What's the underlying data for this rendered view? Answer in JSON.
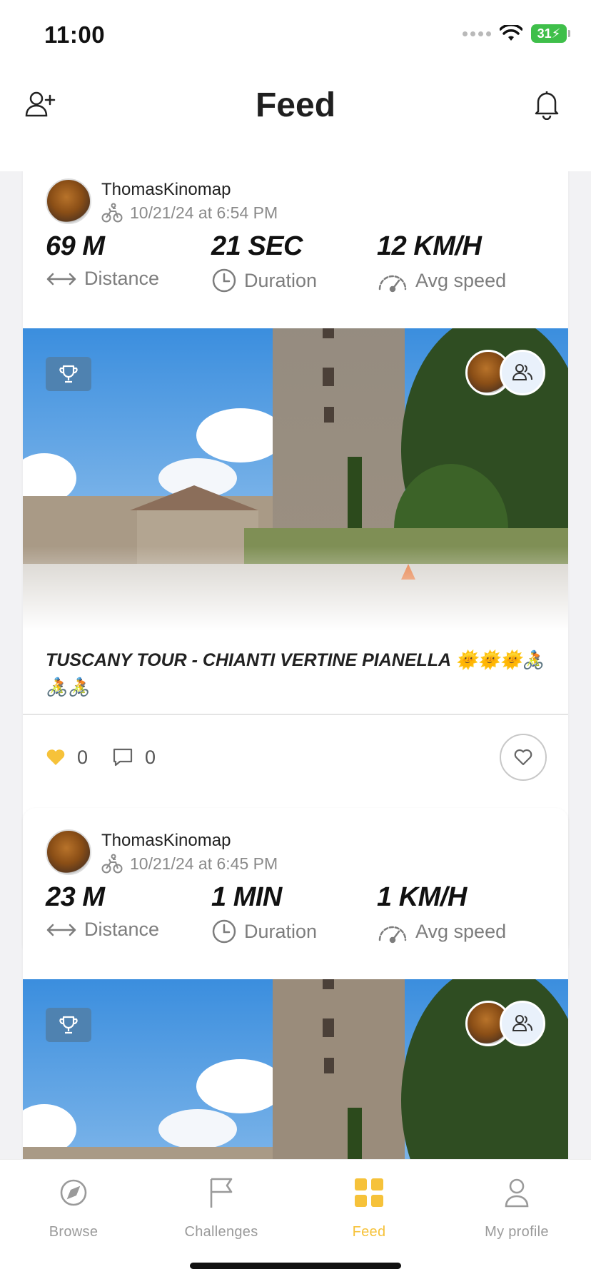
{
  "status_bar": {
    "time": "11:00",
    "battery": "31"
  },
  "header": {
    "title": "Feed",
    "left_icon": "add-friend-icon",
    "right_icon": "bell-icon"
  },
  "posts": [
    {
      "username": "ThomasKinomap",
      "date": "10/21/24 at 6:54 PM",
      "stats": [
        {
          "value": "69 M",
          "label": "Distance",
          "icon": "arrows-horizontal-icon"
        },
        {
          "value": "21 SEC",
          "label": "Duration",
          "icon": "clock-icon"
        },
        {
          "value": "12 KM/H",
          "label": "Avg speed",
          "icon": "speedometer-icon"
        }
      ],
      "title": "TUSCANY TOUR - CHIANTI VERTINE PIANELLA 🌞🌞🌞🚴🚴🚴",
      "likes": "0",
      "comments": "0"
    },
    {
      "username": "ThomasKinomap",
      "date": "10/21/24 at 6:45 PM",
      "stats": [
        {
          "value": "23 M",
          "label": "Distance",
          "icon": "arrows-horizontal-icon"
        },
        {
          "value": "1 MIN",
          "label": "Duration",
          "icon": "clock-icon"
        },
        {
          "value": "1 KM/H",
          "label": "Avg speed",
          "icon": "speedometer-icon"
        }
      ]
    }
  ],
  "nav": {
    "items": [
      {
        "label": "Browse",
        "icon": "compass-icon"
      },
      {
        "label": "Challenges",
        "icon": "flag-icon"
      },
      {
        "label": "Feed",
        "icon": "grid-icon",
        "active": true
      },
      {
        "label": "My profile",
        "icon": "person-icon"
      }
    ]
  },
  "colors": {
    "accent": "#f6c23a",
    "trophy_badge": "#4f82b0",
    "battery": "#3fbf4a"
  }
}
